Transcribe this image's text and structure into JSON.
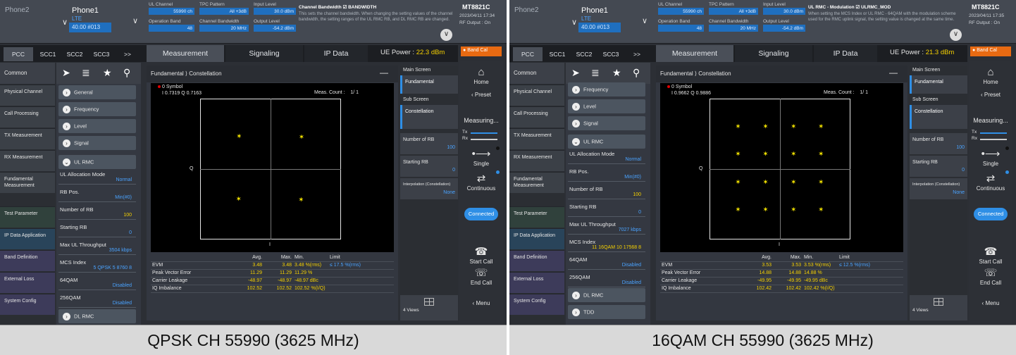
{
  "panels": [
    {
      "header": {
        "phone2": "Phone2",
        "phone1": "Phone1",
        "tech": "LTE",
        "channel_summary": "40.00 #013",
        "ul_channel_label": "UL Channel",
        "ul_channel_value": "55990 ch",
        "tpc_label": "TPC Pattern",
        "tpc_value": "All +3dB",
        "input_level_label": "Input Level",
        "input_level_value": "30.0 dBm",
        "op_band_label": "Operation Band",
        "op_band_value": "48",
        "ch_bw_label": "Channel Bandwidth",
        "ch_bw_value": "20 MHz",
        "output_level_label": "Output Level",
        "output_level_value": "-54.2 dBm",
        "help_title": "Channel Bandwidth ☑ BANDWIDTH",
        "help_text": "This sets the channel bandwidth. When changing the setting values of the channel bandwidth, the setting ranges of the UL RMC RB, and DL RMC RB are changed.",
        "brand": "MT8821C",
        "date": "2023/04/11 17:34",
        "rf_output": "RF Output : On"
      },
      "tabs": {
        "pcc": "PCC",
        "scc1": "SCC1",
        "scc2": "SCC2",
        "scc3": "SCC3",
        "more": ">>",
        "measurement": "Measurement",
        "signaling": "Signaling",
        "ipdata": "IP Data",
        "ue_power_label": "UE Power :",
        "ue_power_value": "22.3 dBm",
        "band_cal": "Band Cal"
      },
      "left_nav": {
        "common": "Common",
        "items": [
          "Physical Channel",
          "Call Processing",
          "TX Measurement",
          "RX Measurement",
          "Fundamental Measurement",
          "Test Parameter",
          "IP Data Application",
          "Band Definition",
          "External Loss",
          "System Config"
        ]
      },
      "settings": {
        "groups": [
          "General",
          "Frequency",
          "Level",
          "Signal",
          "UL RMC"
        ],
        "ul_alloc_label": "UL Allocation Mode",
        "ul_alloc_value": "Normal",
        "rb_pos_label": "RB Pos.",
        "rb_pos_value": "Min(#0)",
        "num_rb_label": "Number of RB",
        "num_rb_value": "100",
        "start_rb_label": "Starting RB",
        "start_rb_value": "0",
        "max_tp_label": "Max UL Throughput",
        "max_tp_value": "3504 kbps",
        "mcs_label": "MCS Index",
        "mcs_value": "5  QPSK  5  8760  8",
        "qam64_label": "64QAM",
        "qam64_value": "Disabled",
        "qam256_label": "256QAM",
        "qam256_value": "Disabled",
        "dl_rmc": "DL RMC"
      },
      "main": {
        "breadcrumb": "Fundamental ⟩ Constellation",
        "symbol": "0 Symbol",
        "symbol_iq": "I 0.7319 Q 0.7163",
        "meas_count_label": "Meas. Count :",
        "meas_count_value": "1/     1",
        "q_axis": "Q",
        "i_axis": "I",
        "table_headers": [
          "",
          "Avg.",
          "Max.",
          "Min.",
          "Limit"
        ],
        "rows": [
          [
            "EVM",
            "3.48",
            "3.48",
            "3.48 %(rms)",
            "≤ 17.5 %(rms)"
          ],
          [
            "Peak Vector Error",
            "11.29",
            "11.29",
            "11.29 %",
            ""
          ],
          [
            "Carrier Leakage",
            "-48.97",
            "-48.97",
            "-48.97 dBc",
            ""
          ],
          [
            "IQ Imbalance",
            "102.52",
            "102.52",
            "102.52 %(I/Q)",
            ""
          ]
        ]
      },
      "right_side": {
        "main_screen": "Main Screen",
        "fundamental": "Fundamental",
        "sub_screen": "Sub Screen",
        "constellation": "Constellation",
        "num_rb_label": "Number of RB",
        "num_rb_value": "100",
        "start_rb_label": "Starting RB",
        "start_rb_value": "0",
        "interp_label": "Interpolation (Constellation)",
        "interp_value": "None",
        "views": "4 Views"
      },
      "far_right": {
        "home": "Home",
        "preset": "Preset",
        "measuring": "Measuring...",
        "tx": "Tx",
        "rx": "Rx",
        "single": "Single",
        "continuous": "Continuous",
        "connected": "Connected",
        "start_call": "Start Call",
        "end_call": "End Call",
        "menu": "Menu"
      },
      "constellation": [
        {
          "i": -0.71,
          "q": 0.72
        },
        {
          "i": 0.72,
          "q": 0.71
        },
        {
          "i": -0.72,
          "q": -0.71
        },
        {
          "i": 0.71,
          "q": -0.72
        }
      ],
      "caption": "QPSK CH 55990 (3625 MHz)"
    },
    {
      "header": {
        "phone2": "Phone2",
        "phone1": "Phone1",
        "tech": "LTE",
        "channel_summary": "40.00 #013",
        "ul_channel_label": "UL Channel",
        "ul_channel_value": "55990 ch",
        "tpc_label": "TPC Pattern",
        "tpc_value": "All +3dB",
        "input_level_label": "Input Level",
        "input_level_value": "30.0 dBm",
        "op_band_label": "Operation Band",
        "op_band_value": "48",
        "ch_bw_label": "Channel Bandwidth",
        "ch_bw_value": "20 MHz",
        "output_level_label": "Output Level",
        "output_level_value": "-54.2 dBm",
        "help_title": "UL RMC - Modulation ☑ ULRMC_MOD",
        "help_text": "When setting the MCS Index or UL RMC - 64QAM with the modulation scheme used for the RMC uplink signal, the setting value is changed at the same time.",
        "brand": "MT8821C",
        "date": "2023/04/11 17:35",
        "rf_output": "RF Output : On"
      },
      "tabs": {
        "pcc": "PCC",
        "scc1": "SCC1",
        "scc2": "SCC2",
        "scc3": "SCC3",
        "more": ">>",
        "measurement": "Measurement",
        "signaling": "Signaling",
        "ipdata": "IP Data",
        "ue_power_label": "UE Power :",
        "ue_power_value": "21.3 dBm",
        "band_cal": "Band Cal"
      },
      "left_nav": {
        "common": "Common",
        "items": [
          "Physical Channel",
          "Call Processing",
          "TX Measurement",
          "RX Measurement",
          "Fundamental Measurement",
          "Test Parameter",
          "IP Data Application",
          "Band Definition",
          "External Loss",
          "System Config"
        ]
      },
      "settings": {
        "groups": [
          "Frequency",
          "Level",
          "Signal",
          "UL RMC"
        ],
        "ul_alloc_label": "UL Allocation Mode",
        "ul_alloc_value": "Normal",
        "rb_pos_label": "RB Pos.",
        "rb_pos_value": "Min(#0)",
        "num_rb_label": "Number of RB",
        "num_rb_value": "100",
        "start_rb_label": "Starting RB",
        "start_rb_value": "0",
        "max_tp_label": "Max UL Throughput",
        "max_tp_value": "7027 kbps",
        "mcs_label": "MCS Index",
        "mcs_value": "11  16QAM  10  17568  8",
        "qam64_label": "64QAM",
        "qam64_value": "Disabled",
        "qam256_label": "256QAM",
        "qam256_value": "Disabled",
        "dl_rmc": "DL RMC",
        "tdd": "TDD"
      },
      "main": {
        "breadcrumb": "Fundamental ⟩ Constellation",
        "symbol": "0 Symbol",
        "symbol_iq": "I 0.9662 Q 0.9886",
        "meas_count_label": "Meas. Count :",
        "meas_count_value": "1/     1",
        "q_axis": "Q",
        "i_axis": "I",
        "table_headers": [
          "",
          "Avg.",
          "Max.",
          "Min.",
          "Limit"
        ],
        "rows": [
          [
            "EVM",
            "3.53",
            "3.53",
            "3.53 %(rms)",
            "≤ 12.5 %(rms)"
          ],
          [
            "Peak Vector Error",
            "14.88",
            "14.88",
            "14.88 %",
            ""
          ],
          [
            "Carrier Leakage",
            "-49.95",
            "-49.95",
            "-49.95 dBc",
            ""
          ],
          [
            "IQ Imbalance",
            "102.42",
            "102.42",
            "102.42 %(I/Q)",
            ""
          ]
        ]
      },
      "right_side": {
        "main_screen": "Main Screen",
        "fundamental": "Fundamental",
        "sub_screen": "Sub Screen",
        "constellation": "Constellation",
        "num_rb_label": "Number of RB",
        "num_rb_value": "100",
        "start_rb_label": "Starting RB",
        "start_rb_value": "0",
        "interp_label": "Interpolation (Constellation)",
        "interp_value": "None",
        "views": "4 Views"
      },
      "far_right": {
        "home": "Home",
        "preset": "Preset",
        "measuring": "Measuring...",
        "tx": "Tx",
        "rx": "Rx",
        "single": "Single",
        "continuous": "Continuous",
        "connected": "Connected",
        "start_call": "Start Call",
        "end_call": "End Call",
        "menu": "Menu"
      },
      "constellation": [
        {
          "i": -0.95,
          "q": 0.95
        },
        {
          "i": -0.32,
          "q": 0.95
        },
        {
          "i": 0.32,
          "q": 0.95
        },
        {
          "i": 0.95,
          "q": 0.95
        },
        {
          "i": -0.95,
          "q": 0.32
        },
        {
          "i": -0.32,
          "q": 0.32
        },
        {
          "i": 0.32,
          "q": 0.32
        },
        {
          "i": 0.95,
          "q": 0.32
        },
        {
          "i": -0.95,
          "q": -0.32
        },
        {
          "i": -0.32,
          "q": -0.32
        },
        {
          "i": 0.32,
          "q": -0.32
        },
        {
          "i": 0.95,
          "q": -0.32
        },
        {
          "i": -0.95,
          "q": -0.95
        },
        {
          "i": -0.32,
          "q": -0.95
        },
        {
          "i": 0.32,
          "q": -0.95
        },
        {
          "i": 0.95,
          "q": -0.95
        }
      ],
      "caption": "16QAM CH 55990 (3625 MHz)"
    }
  ],
  "colors": {
    "accent": "#2f8fe6",
    "value_yellow": "#f5d000",
    "value_blue": "#4aa3ff",
    "band_cal": "#e86a12"
  },
  "icons": [
    "home-icon",
    "preset-icon",
    "single-icon",
    "continuous-icon",
    "start-call-icon",
    "end-call-icon",
    "menu-icon",
    "search-icon",
    "star-icon",
    "grid-icon"
  ]
}
